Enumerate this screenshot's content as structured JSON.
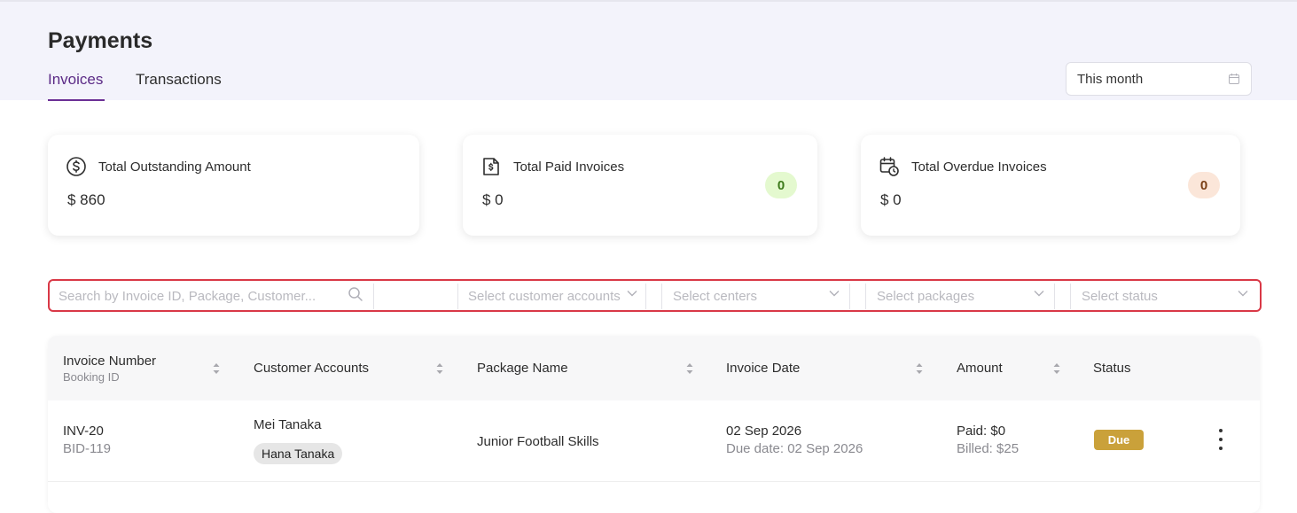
{
  "header": {
    "title": "Payments",
    "tabs": [
      {
        "label": "Invoices",
        "active": true
      },
      {
        "label": "Transactions",
        "active": false
      }
    ],
    "date_filter": {
      "value": "This month",
      "icon": "calendar-icon"
    }
  },
  "summary_cards": [
    {
      "title": "Total Outstanding Amount",
      "value": "$ 860",
      "icon": "dollar-circle-icon"
    },
    {
      "title": "Total Paid Invoices",
      "value": "$ 0",
      "badge": "0",
      "badge_color": "#e4f9cf",
      "badge_text_color": "#3c7a1a",
      "icon": "paid-receipt-icon"
    },
    {
      "title": "Total Overdue Invoices",
      "value": "$ 0",
      "badge": "0",
      "badge_color": "#fbe6d9",
      "badge_text_color": "#7a3e14",
      "icon": "calendar-clock-icon"
    }
  ],
  "filters": {
    "search_placeholder": "Search by Invoice ID, Package, Customer...",
    "customer_accounts_placeholder": "Select customer accounts",
    "centers_placeholder": "Select centers",
    "packages_placeholder": "Select packages",
    "status_placeholder": "Select status"
  },
  "table": {
    "columns": {
      "invoice_number": "Invoice Number",
      "booking_id": "Booking ID",
      "customer_accounts": "Customer Accounts",
      "package_name": "Package Name",
      "invoice_date": "Invoice Date",
      "amount": "Amount",
      "status": "Status"
    },
    "rows": [
      {
        "invoice_number": "INV-20",
        "booking_id": "BID-119",
        "customer": "Mei Tanaka",
        "member_chip": "Hana Tanaka",
        "package": "Junior Football Skills",
        "invoice_date": "02 Sep 2026",
        "due_date": "Due date: 02 Sep 2026",
        "paid": "Paid: $0",
        "billed": "Billed: $25",
        "status": "Due"
      }
    ]
  },
  "colors": {
    "accent": "#5b2a86",
    "filter_border": "#d93846",
    "due_badge": "#caa13a",
    "header_bg": "#f3f3fb"
  }
}
